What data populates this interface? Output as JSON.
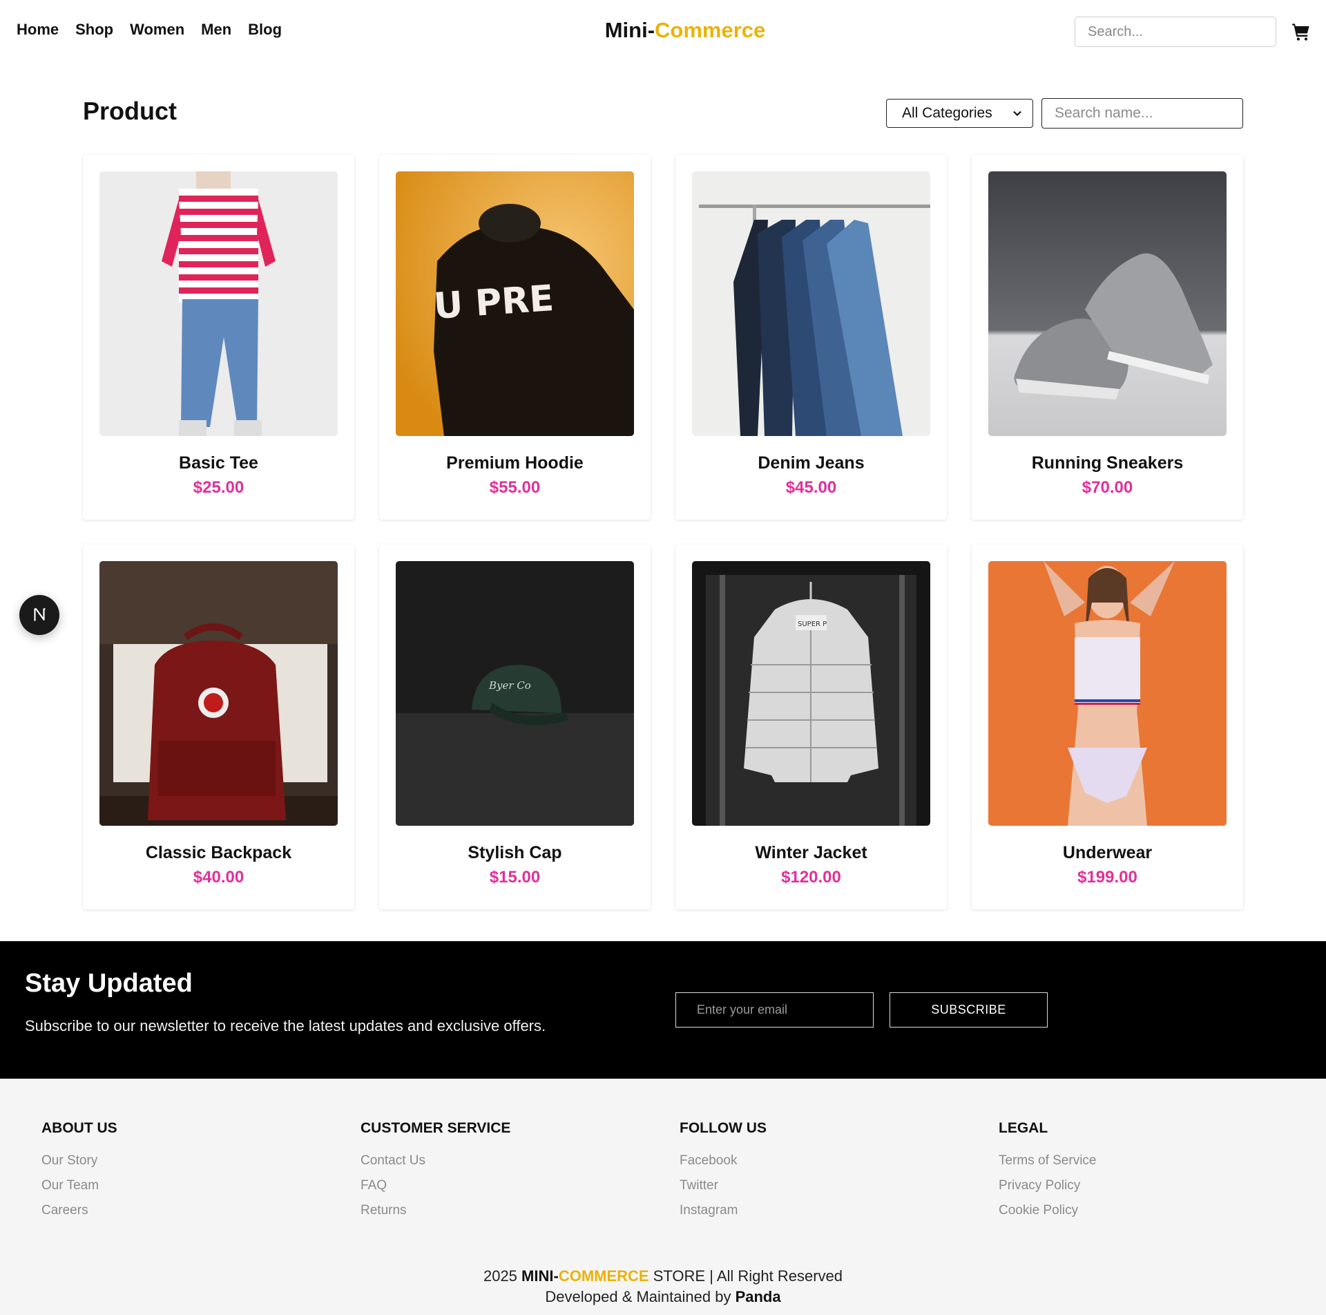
{
  "header": {
    "nav": [
      "Home",
      "Shop",
      "Women",
      "Men",
      "Blog"
    ],
    "logo_part1": "Mini-",
    "logo_part2": "Commerce",
    "search_placeholder": "Search...",
    "accent_color": "#eab308"
  },
  "products_section": {
    "title": "Product",
    "category_selected": "All Categories",
    "name_search_placeholder": "Search name...",
    "price_color": "#e0309a",
    "items": [
      {
        "name": "Basic Tee",
        "price": "$25.00",
        "image": "striped-tee-photo"
      },
      {
        "name": "Premium Hoodie",
        "price": "$55.00",
        "image": "hoodie-photo"
      },
      {
        "name": "Denim Jeans",
        "price": "$45.00",
        "image": "jeans-rack-photo"
      },
      {
        "name": "Running Sneakers",
        "price": "$70.00",
        "image": "sneakers-photo"
      },
      {
        "name": "Classic Backpack",
        "price": "$40.00",
        "image": "backpack-photo"
      },
      {
        "name": "Stylish Cap",
        "price": "$15.00",
        "image": "cap-photo"
      },
      {
        "name": "Winter Jacket",
        "price": "$120.00",
        "image": "puffer-jacket-photo"
      },
      {
        "name": "Underwear",
        "price": "$199.00",
        "image": "underwear-photo"
      }
    ]
  },
  "newsletter": {
    "title": "Stay Updated",
    "text": "Subscribe to our newsletter to receive the latest updates and exclusive offers.",
    "email_placeholder": "Enter your email",
    "button": "SUBSCRIBE"
  },
  "footer": {
    "columns": [
      {
        "title": "ABOUT US",
        "links": [
          "Our Story",
          "Our Team",
          "Careers"
        ]
      },
      {
        "title": "CUSTOMER SERVICE",
        "links": [
          "Contact Us",
          "FAQ",
          "Returns"
        ]
      },
      {
        "title": "FOLLOW US",
        "links": [
          "Facebook",
          "Twitter",
          "Instagram"
        ]
      },
      {
        "title": "LEGAL",
        "links": [
          "Terms of Service",
          "Privacy Policy",
          "Cookie Policy"
        ]
      }
    ],
    "copyright_year": "2025",
    "copyright_brand1": "MINI-",
    "copyright_brand2": "COMMERCE",
    "copyright_rest": "STORE | All Right Reserved",
    "developed_by_prefix": "Developed & Maintained by",
    "developer": "Panda"
  },
  "icons": {
    "cart": "cart-icon",
    "dev_badge": "nextjs-badge-icon"
  }
}
